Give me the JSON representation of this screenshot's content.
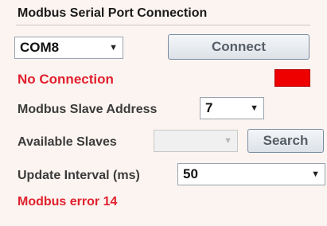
{
  "section": {
    "title": "Modbus Serial Port Connection"
  },
  "port": {
    "selected": "COM8",
    "connect_label": "Connect"
  },
  "status": {
    "text": "No Connection",
    "indicator_color": "#ee0000"
  },
  "slave_address": {
    "label": "Modbus Slave Address",
    "value": "7"
  },
  "available_slaves": {
    "label": "Available Slaves",
    "value": "",
    "search_label": "Search"
  },
  "update_interval": {
    "label": "Update Interval (ms)",
    "value": "50"
  },
  "error": {
    "text": "Modbus error 14"
  }
}
